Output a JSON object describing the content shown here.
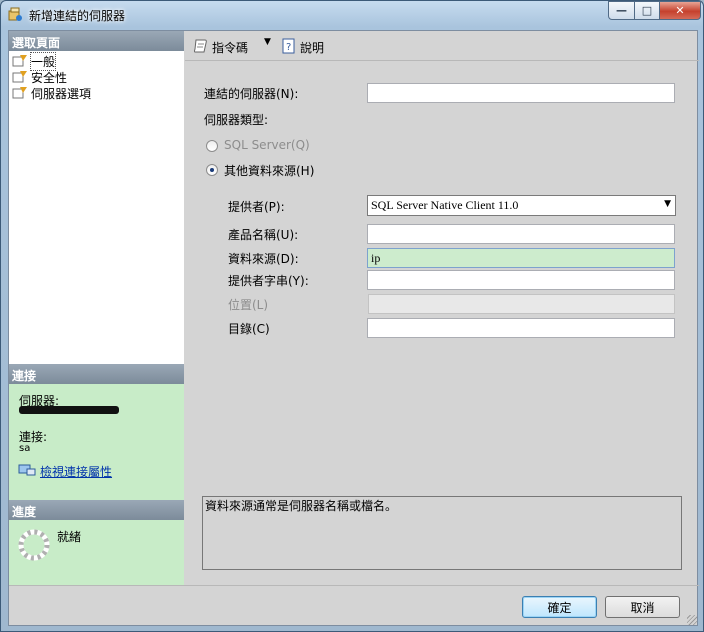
{
  "window": {
    "title": "新增連結的伺服器",
    "controls": {
      "minimize": "—",
      "maximize": "□",
      "close": "✕"
    }
  },
  "left": {
    "pages_header": "選取頁面",
    "pages": [
      {
        "label": "一般",
        "selected": true
      },
      {
        "label": "安全性",
        "selected": false
      },
      {
        "label": "伺服器選項",
        "selected": false
      }
    ],
    "connection": {
      "header": "連接",
      "server_label": "伺服器:",
      "conn_label": "連接:",
      "conn_value": "sa",
      "view_link": "檢視連接屬性"
    },
    "progress": {
      "header": "進度",
      "status": "就緒"
    }
  },
  "toolbar": {
    "script_label": "指令碼",
    "help_label": "說明"
  },
  "form": {
    "linked_server_label": "連結的伺服器(N):",
    "linked_server_value": "",
    "server_type_label": "伺服器類型:",
    "radio_sql": "SQL Server(Q)",
    "radio_other": "其他資料來源(H)",
    "provider_label": "提供者(P):",
    "provider_value": "SQL Server Native Client 11.0",
    "product_label": "產品名稱(U):",
    "product_value": "",
    "datasource_label": "資料來源(D):",
    "datasource_value": "ip",
    "providerstr_label": "提供者字串(Y):",
    "providerstr_value": "",
    "location_label": "位置(L)",
    "location_value": "",
    "catalog_label": "目錄(C)",
    "catalog_value": ""
  },
  "description": "資料來源通常是伺服器名稱或檔名。",
  "footer": {
    "ok": "確定",
    "cancel": "取消"
  },
  "colors": {
    "green_panel": "#c8ecc8",
    "header_gray": "#8999a8",
    "link_blue": "#0033aa"
  }
}
